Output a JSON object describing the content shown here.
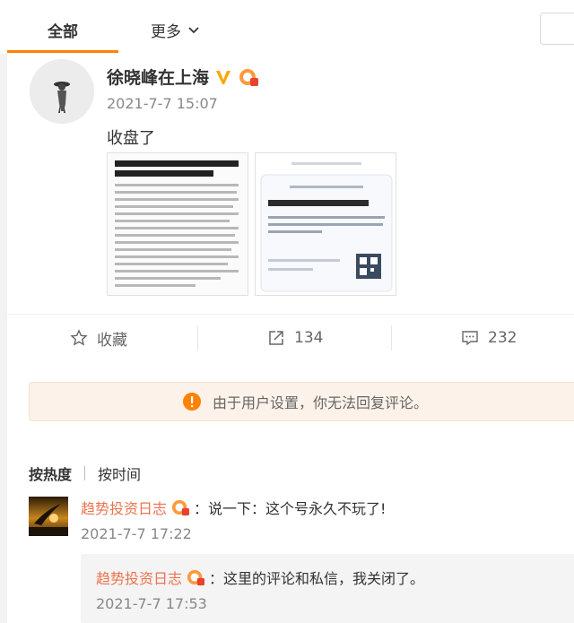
{
  "tabs": {
    "all": "全部",
    "more": "更多"
  },
  "post": {
    "author": "徐晓峰在上海",
    "time": "2021-7-7 15:07",
    "text": "收盘了",
    "pics": [
      "market-report-image",
      "north-capital-image"
    ]
  },
  "actions": {
    "favorite": "收藏",
    "share_count": "134",
    "comment_count": "232"
  },
  "notice": "由于用户设置，你无法回复评论。",
  "sort": {
    "hot": "按热度",
    "time": "按时间"
  },
  "comment": {
    "user": "趋势投资日志",
    "text": "：说一下：这个号永久不玩了!",
    "time": "2021-7-7 17:22",
    "reply": {
      "user": "趋势投资日志",
      "text": "：这里的评论和私信，我关闭了。",
      "time": "2021-7-7 17:53"
    }
  },
  "colors": {
    "accent": "#ff8200",
    "username": "#eb7350"
  }
}
